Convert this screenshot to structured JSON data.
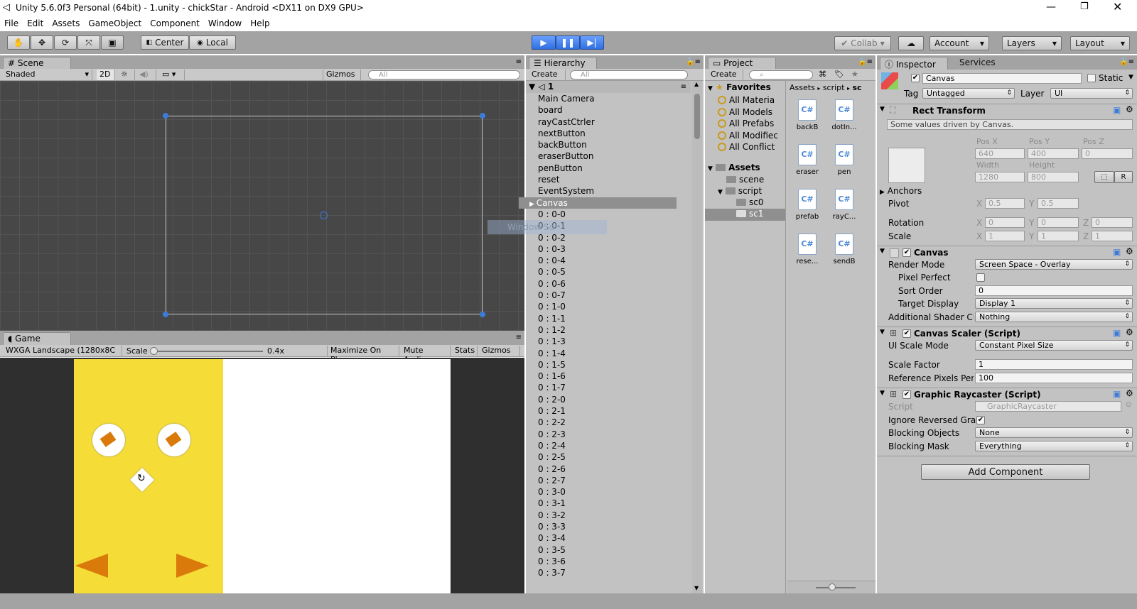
{
  "window": {
    "title": "Unity 5.6.0f3 Personal (64bit) - 1.unity - chickStar - Android <DX11 on DX9 GPU>"
  },
  "menu": [
    "File",
    "Edit",
    "Assets",
    "GameObject",
    "Component",
    "Window",
    "Help"
  ],
  "toolbar": {
    "center": "Center",
    "local": "Local",
    "collab": "Collab",
    "account": "Account",
    "layers": "Layers",
    "layout": "Layout"
  },
  "scene": {
    "tab": "Scene",
    "shading": "Shaded",
    "mode2d": "2D",
    "gizmos": "Gizmos",
    "search": "All"
  },
  "game": {
    "tab": "Game",
    "resolution": "WXGA Landscape (1280x8C",
    "scale_label": "Scale",
    "scale_value": "0.4x",
    "scale_level": 0.0,
    "maximize": "Maximize On Play",
    "mute": "Mute Audio",
    "stats": "Stats",
    "gizmos": "Gizmos"
  },
  "hierarchy": {
    "tab": "Hierarchy",
    "create": "Create",
    "search": "All",
    "root": "1",
    "items": [
      "Main Camera",
      "board",
      "rayCastCtrler",
      "nextButton",
      "backButton",
      "eraserButton",
      "penButton",
      "reset",
      "EventSystem",
      "Canvas"
    ],
    "selected": "Canvas",
    "children": [
      "0 : 0-0",
      "0 : 0-1",
      "0 : 0-2",
      "0 : 0-3",
      "0 : 0-4",
      "0 : 0-5",
      "0 : 0-6",
      "0 : 0-7",
      "0 : 1-0",
      "0 : 1-1",
      "0 : 1-2",
      "0 : 1-3",
      "0 : 1-4",
      "0 : 1-5",
      "0 : 1-6",
      "0 : 1-7",
      "0 : 2-0",
      "0 : 2-1",
      "0 : 2-2",
      "0 : 2-3",
      "0 : 2-4",
      "0 : 2-5",
      "0 : 2-6",
      "0 : 2-7",
      "0 : 3-0",
      "0 : 3-1",
      "0 : 3-2",
      "0 : 3-3",
      "0 : 3-4",
      "0 : 3-5",
      "0 : 3-6",
      "0 : 3-7"
    ],
    "overlay": "Window Sc"
  },
  "project": {
    "tab": "Project",
    "create": "Create",
    "favorites_label": "Favorites",
    "favorites": [
      "All Materia",
      "All Models",
      "All Prefabs",
      "All Modifiec",
      "All Conflict"
    ],
    "assets_label": "Assets",
    "folders": [
      "scene",
      "script",
      "sc0",
      "sc1"
    ],
    "breadcrumb": [
      "Assets",
      "script",
      "sc"
    ],
    "files": [
      "backB",
      "dotIn...",
      "eraser",
      "pen",
      "prefab",
      "rayC...",
      "rese...",
      "sendB"
    ]
  },
  "inspector": {
    "tab": "Inspector",
    "services": "Services",
    "object_name": "Canvas",
    "static_label": "Static",
    "tag_label": "Tag",
    "tag": "Untagged",
    "layer_label": "Layer",
    "layer": "UI",
    "rect_transform": {
      "title": "Rect Transform",
      "note": "Some values driven by Canvas.",
      "pos_x_label": "Pos X",
      "pos_y_label": "Pos Y",
      "pos_z_label": "Pos Z",
      "pos_x": "640",
      "pos_y": "400",
      "pos_z": "0",
      "width_label": "Width",
      "height_label": "Height",
      "width": "1280",
      "height": "800",
      "r_btn": "R",
      "anchors": "Anchors",
      "pivot": "Pivot",
      "pivot_x": "0.5",
      "pivot_y": "0.5",
      "rotation": "Rotation",
      "rot_x": "0",
      "rot_y": "0",
      "rot_z": "0",
      "scale": "Scale",
      "scale_x": "1",
      "scale_y": "1",
      "scale_z": "1",
      "x": "X",
      "y": "Y",
      "z": "Z"
    },
    "canvas": {
      "title": "Canvas",
      "render_mode_label": "Render Mode",
      "render_mode": "Screen Space - Overlay",
      "pixel_perfect_label": "Pixel Perfect",
      "sort_order_label": "Sort Order",
      "sort_order": "0",
      "target_display_label": "Target Display",
      "target_display": "Display 1",
      "shader_label": "Additional Shader Cl",
      "shader": "Nothing"
    },
    "scaler": {
      "title": "Canvas Scaler (Script)",
      "mode_label": "UI Scale Mode",
      "mode": "Constant Pixel Size",
      "factor_label": "Scale Factor",
      "factor": "1",
      "ref_label": "Reference Pixels Per",
      "ref": "100"
    },
    "raycaster": {
      "title": "Graphic Raycaster (Script)",
      "script_label": "Script",
      "script": "GraphicRaycaster",
      "ignore_label": "Ignore Reversed Gra",
      "blocking_label": "Blocking Objects",
      "blocking": "None",
      "mask_label": "Blocking Mask",
      "mask": "Everything"
    },
    "add_component": "Add Component"
  },
  "colors": {
    "game_bg": "#f5dc36",
    "arrow": "#d97a0b",
    "selection": "#3b7bd9"
  }
}
